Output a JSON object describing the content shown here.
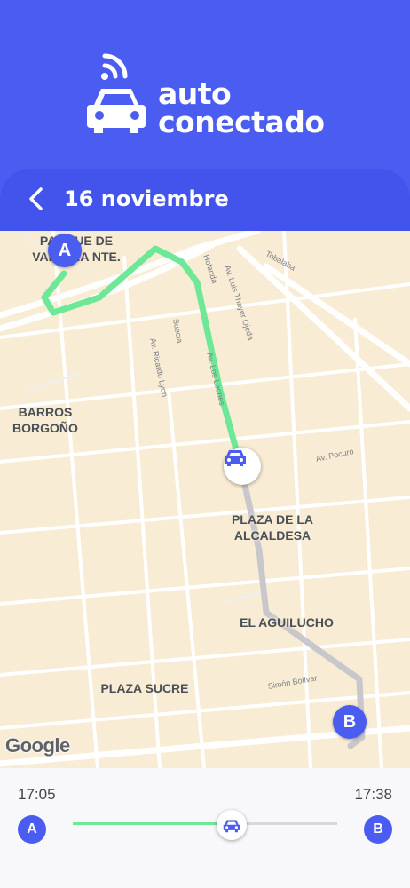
{
  "brand": {
    "line1": "auto",
    "line2": "conectado"
  },
  "header": {
    "date": "16 noviembre"
  },
  "colors": {
    "primary": "#4a5df0",
    "route_done": "#6ee797",
    "route_pending": "#c8c8cc",
    "map_bg": "#f8ecd4"
  },
  "icons": {
    "logo": "car-signal-icon",
    "back": "chevron-left-icon",
    "car": "car-icon"
  },
  "map": {
    "places": {
      "valdivia": "PARQUE DE VALDIVIA NTE.",
      "barros": "BARROS BORGOÑO",
      "alcaldesa": "PLAZA DE LA ALCALDESA",
      "aguilucho": "EL AGUILUCHO",
      "sucre": "PLAZA SUCRE"
    },
    "streets": {
      "holanda": "Holanda",
      "thayer": "Av. Luis Thayer Ojeda",
      "tobalaba": "Tobalaba",
      "suecia": "Suecia",
      "lyon": "Av. Ricardo Lyon",
      "leones": "Av. Los Leones",
      "pocuro": "Av. Pocuro",
      "bolivar": "Simón Bolívar"
    },
    "start_label": "A",
    "end_label": "B",
    "attribution": "Google"
  },
  "timeline": {
    "start_time": "17:05",
    "end_time": "17:38",
    "start_label": "A",
    "end_label": "B",
    "progress": 0.6
  }
}
